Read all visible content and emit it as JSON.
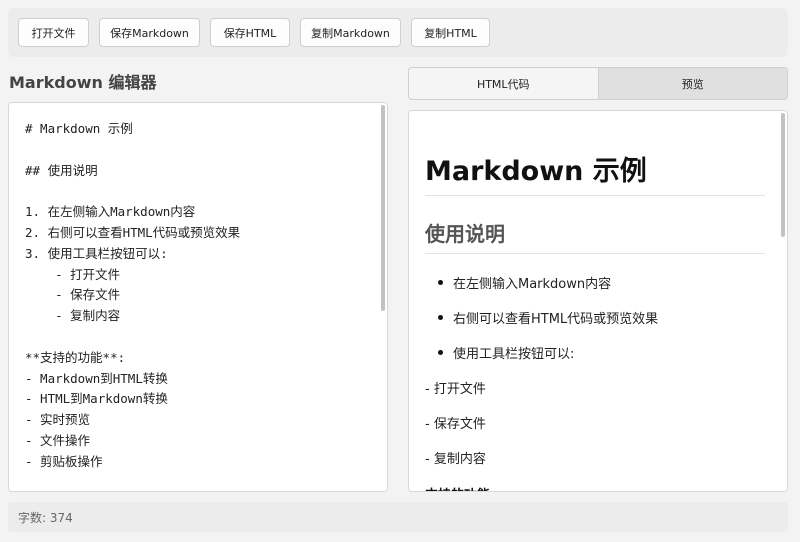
{
  "toolbar": {
    "buttons": [
      "打开文件",
      "保存Markdown",
      "保存HTML",
      "复制Markdown",
      "复制HTML"
    ]
  },
  "editor": {
    "title": "Markdown 编辑器",
    "lines": [
      "# Markdown 示例",
      "",
      "## 使用说明",
      "",
      "1. 在左侧输入Markdown内容",
      "2. 右侧可以查看HTML代码或预览效果",
      "3. 使用工具栏按钮可以:",
      "    - 打开文件",
      "    - 保存文件",
      "    - 复制内容",
      "",
      "**支持的功能**:",
      "- Markdown到HTML转换",
      "- HTML到Markdown转换",
      "- 实时预览",
      "- 文件操作",
      "- 剪贴板操作"
    ]
  },
  "tabs": [
    {
      "label": "HTML代码",
      "active": false
    },
    {
      "label": "预览",
      "active": true
    }
  ],
  "preview": {
    "h1": "Markdown 示例",
    "h2": "使用说明",
    "list_items": [
      "在左侧输入Markdown内容",
      "右侧可以查看HTML代码或预览效果",
      "使用工具栏按钮可以:"
    ],
    "paragraphs": [
      "- 打开文件",
      "- 保存文件",
      "- 复制内容"
    ],
    "strong": "支持的功能:"
  },
  "status": {
    "char_count": "字数: 374"
  }
}
